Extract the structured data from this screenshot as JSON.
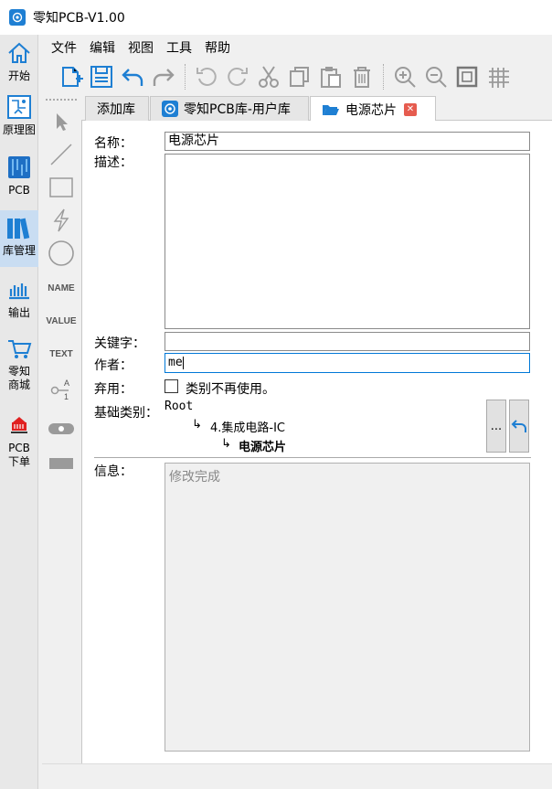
{
  "window": {
    "title": "零知PCB-V1.00"
  },
  "nav": [
    {
      "label": "开始",
      "icon": "home-icon"
    },
    {
      "label": "原理图",
      "icon": "schematic-icon"
    },
    {
      "label": "PCB",
      "icon": "pcb-icon"
    },
    {
      "label": "库管理",
      "icon": "library-icon",
      "active": true
    },
    {
      "label": "输出",
      "icon": "output-icon"
    },
    {
      "label1": "零知",
      "label2": "商城",
      "icon": "cart-icon"
    },
    {
      "label1": "PCB",
      "label2": "下单",
      "icon": "order-icon"
    }
  ],
  "menu": [
    "文件",
    "编辑",
    "视图",
    "工具",
    "帮助"
  ],
  "toolbar": [
    "new-icon",
    "save-icon",
    "undo-icon",
    "redo-icon",
    "rotate-left-icon",
    "rotate-right-icon",
    "cut-icon",
    "copy-icon",
    "paste-icon",
    "delete-icon",
    "zoom-in-icon",
    "zoom-out-icon",
    "fit-icon",
    "grid-icon"
  ],
  "tools": {
    "name": "NAME",
    "value": "VALUE",
    "text": "TEXT"
  },
  "tabs": [
    {
      "label": "添加库"
    },
    {
      "label": "零知PCB库-用户库"
    },
    {
      "label": "电源芯片"
    }
  ],
  "form": {
    "name_label": "名称：",
    "name_value": "电源芯片",
    "desc_label": "描述：",
    "desc_value": "",
    "keyword_label": "关键字：",
    "keyword_value": "",
    "author_label": "作者：",
    "author_value": "me",
    "deprecated_label": "弃用：",
    "deprecated_checkbox_label": "类别不再使用。",
    "deprecated_checked": false,
    "category_label": "基础类别：",
    "category_root": "Root",
    "category_level1": "4.集成电路-IC",
    "category_level2": "电源芯片",
    "browse_button": "...",
    "info_label": "信息：",
    "info_value": "修改完成"
  },
  "colors": {
    "accent": "#1e7fd3",
    "active_nav": "#c9ddf2",
    "close": "#e65c4f"
  }
}
